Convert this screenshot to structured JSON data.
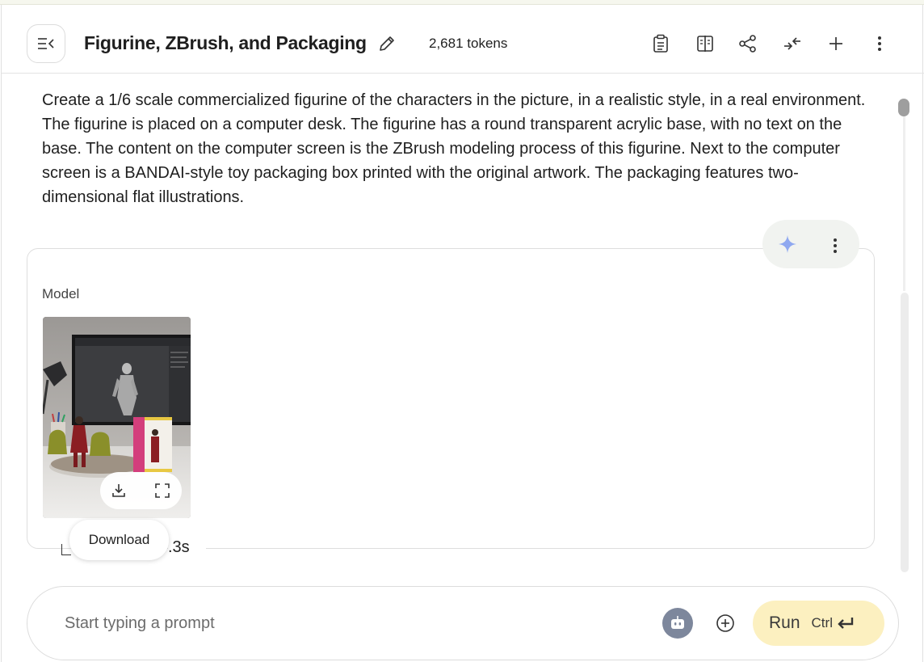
{
  "header": {
    "title": "Figurine, ZBrush, and Packaging",
    "tokens": "2,681 tokens"
  },
  "prompt": {
    "text": "Create a 1/6 scale commercialized figurine of the characters in the picture, in a realistic style, in a real environment. The figurine is placed on a computer desk. The figurine has a round transparent acrylic base, with no text on the base. The content on the computer screen is the ZBrush modeling process of this figurine. Next to the computer screen is a BANDAI-style toy packaging box printed with the original artwork. The packaging features two-dimensional flat illustrations."
  },
  "model": {
    "label": "Model",
    "tooltip": "Download",
    "time_fragment": ".3s"
  },
  "input": {
    "placeholder": "Start typing a prompt"
  },
  "run": {
    "label": "Run",
    "shortcut": "Ctrl"
  },
  "icons": {
    "menu": "collapse-menu-icon",
    "edit": "pencil-icon",
    "toolbar": [
      "clipboard-icon",
      "compare-icon",
      "share-icon",
      "collapse-icon",
      "plus-icon",
      "more-vertical-icon"
    ],
    "card": [
      "sparkle-icon",
      "more-vertical-icon"
    ],
    "image": [
      "download-icon",
      "fullscreen-icon"
    ],
    "input": [
      "robot-icon",
      "add-circle-icon",
      "enter-icon"
    ]
  },
  "colors": {
    "accent_sparkle": "#8fa8f0",
    "run_button": "#fcf0c0",
    "robot_button": "#7d879c"
  }
}
